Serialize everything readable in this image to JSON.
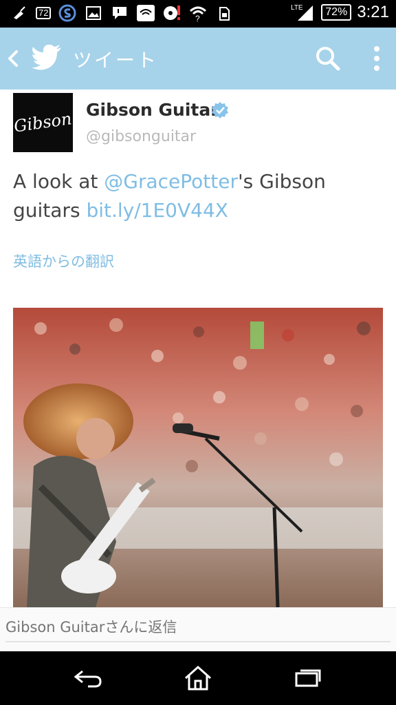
{
  "status_bar": {
    "notif_count": "72",
    "network": "LTE",
    "battery": "72%",
    "time": "3:21",
    "left_icons": [
      "broom-icon",
      "notification-count-icon",
      "sync-s-icon",
      "image-icon",
      "chat-icon",
      "wifi-on-icon",
      "disc-alert-icon",
      "wifi-question-icon",
      "sim-icon"
    ],
    "right_icons": [
      "signal-icon",
      "battery-icon"
    ]
  },
  "app_bar": {
    "title": "ツイート",
    "background": "#a6d3ea",
    "icons": [
      "back-icon",
      "twitter-bird-icon",
      "search-icon",
      "more-vert-icon"
    ]
  },
  "tweet": {
    "user_name": "Gibson Guitar",
    "handle": "@gibsonguitar",
    "avatar_logo_text": "Gibson",
    "text_prefix": "A look at ",
    "mention": "@GracePotter",
    "text_middle": "'s Gibson guitars ",
    "link": "bit.ly/1E0V44X",
    "translate_label": "英語からの翻訳",
    "accent_color": "#7fbde3"
  },
  "reply": {
    "placeholder": "Gibson Guitarさんに返信"
  },
  "nav_bar": {
    "icons": [
      "back-arrow-icon",
      "home-icon",
      "recent-apps-icon"
    ]
  }
}
